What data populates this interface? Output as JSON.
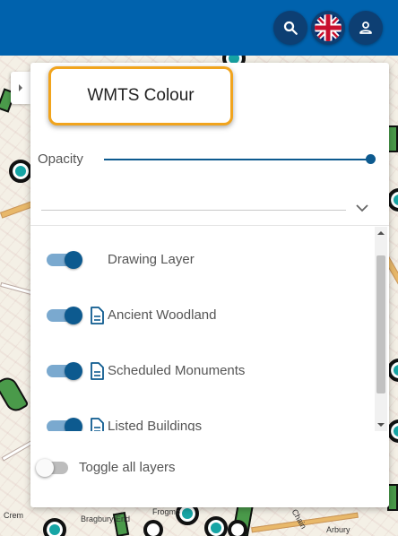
{
  "header": {
    "buttons": {
      "search_icon": "search-icon",
      "language_icon": "uk-flag-icon",
      "account_icon": "person-icon"
    },
    "brand_color": "#0062ad"
  },
  "map": {
    "labels": [
      "Crem",
      "Bragbury End",
      "Frogmo",
      "Arbury",
      "Chain"
    ]
  },
  "panel": {
    "title": "WMTS Colour",
    "opacity_label": "Opacity",
    "opacity_value": 1.0,
    "select_value": "",
    "layers": [
      {
        "label": "Drawing Layer",
        "enabled": true,
        "has_doc_icon": false
      },
      {
        "label": "Ancient Woodland",
        "enabled": true,
        "has_doc_icon": true
      },
      {
        "label": "Scheduled Monuments",
        "enabled": true,
        "has_doc_icon": true
      },
      {
        "label": "Listed Buildings",
        "enabled": true,
        "has_doc_icon": true
      }
    ],
    "toggle_all_label": "Toggle all layers",
    "toggle_all_enabled": false,
    "accent_color": "#0d5a8f",
    "highlight_color": "#f1a41d"
  }
}
